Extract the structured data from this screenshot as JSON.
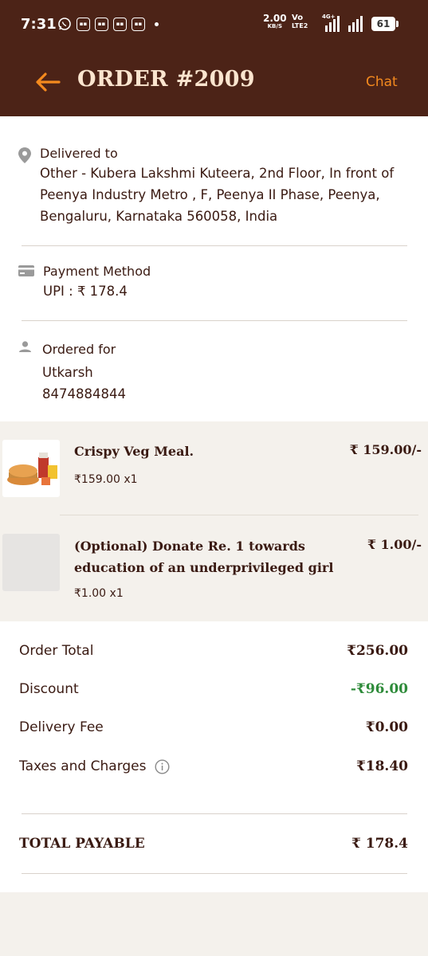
{
  "status_bar": {
    "time": "7:31",
    "net_speed": "2.00",
    "net_unit": "KB/S",
    "volte": "Vo",
    "lte": "LTE2",
    "network_type": "4G+",
    "battery": "61"
  },
  "header": {
    "title": "ORDER #2009",
    "chat_label": "Chat",
    "back_icon": "back-arrow-icon",
    "accent_color": "#f48a1e",
    "bg_color": "#4c2317"
  },
  "delivery": {
    "label": "Delivered to",
    "address_line1": "Other - Kubera Lakshmi Kuteera, 2nd Floor, In front of",
    "address_line2": "Peenya Industry Metro ,  F, Peenya II Phase, Peenya,",
    "address_line3": "Bengaluru, Karnataka 560058, India"
  },
  "payment": {
    "label": "Payment Method",
    "value": "UPI : ₹ 178.4"
  },
  "ordered_for": {
    "label": "Ordered for",
    "name": "Utkarsh",
    "phone": "8474884844"
  },
  "items": [
    {
      "name": "Crispy Veg Meal.",
      "qty": "₹159.00 x1",
      "price": "₹ 159.00/-"
    },
    {
      "name_line1": "(Optional) Donate Re. 1 towards",
      "name_line2": "education of an underprivileged girl",
      "qty": "₹1.00 x1",
      "price": "₹ 1.00/-"
    }
  ],
  "summary": {
    "order_total_label": "Order Total",
    "order_total_value": "₹256.00",
    "discount_label": "Discount",
    "discount_value": "-₹96.00",
    "delivery_fee_label": "Delivery Fee",
    "delivery_fee_value": "₹0.00",
    "taxes_label": "Taxes and Charges",
    "taxes_value": "₹18.40",
    "total_label": "TOTAL PAYABLE",
    "total_value": "₹ 178.4",
    "discount_color": "#2e8b3a"
  }
}
